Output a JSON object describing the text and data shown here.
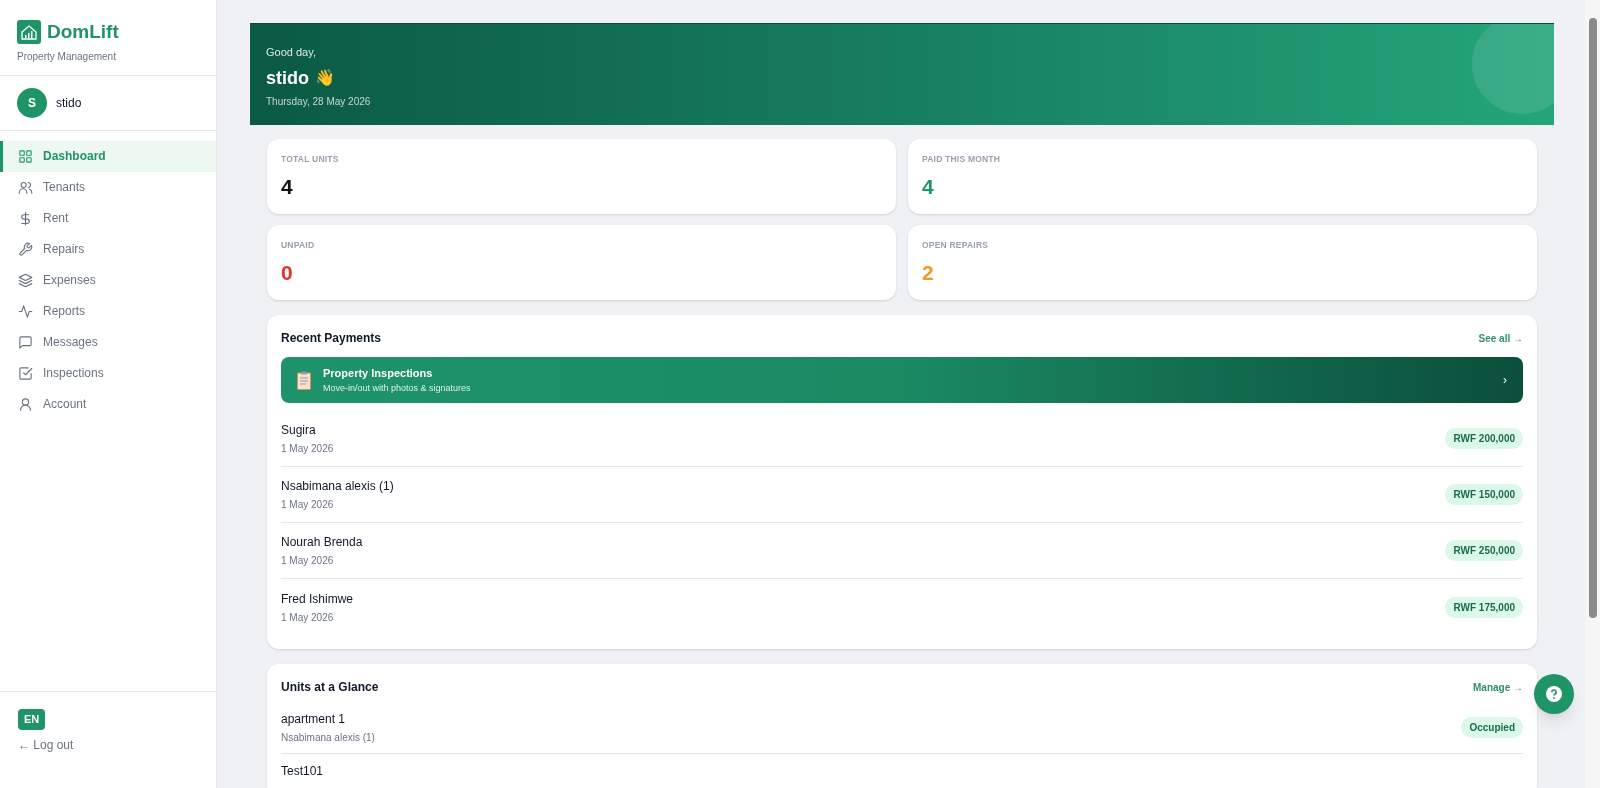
{
  "brand": {
    "name": "DomLift",
    "tagline": "Property Management"
  },
  "user": {
    "initial": "S",
    "name": "stido"
  },
  "nav": [
    {
      "label": "Dashboard",
      "selected": true
    },
    {
      "label": "Tenants",
      "selected": false
    },
    {
      "label": "Rent",
      "selected": false
    },
    {
      "label": "Repairs",
      "selected": false
    },
    {
      "label": "Expenses",
      "selected": false
    },
    {
      "label": "Reports",
      "selected": false
    },
    {
      "label": "Messages",
      "selected": false
    },
    {
      "label": "Inspections",
      "selected": false
    },
    {
      "label": "Account",
      "selected": false
    }
  ],
  "language": "EN",
  "logout": "← Log out",
  "greeting": {
    "salutation": "Good day,",
    "name": "stido",
    "emoji": "👋",
    "date": "Thursday, 28 May 2026"
  },
  "stats": [
    {
      "label": "TOTAL UNITS",
      "value": "4",
      "color": "#111111"
    },
    {
      "label": "PAID THIS MONTH",
      "value": "4",
      "color": "#1f9467"
    },
    {
      "label": "UNPAID",
      "value": "0",
      "color": "#e5322d"
    },
    {
      "label": "OPEN REPAIRS",
      "value": "2",
      "color": "#f29a1f"
    }
  ],
  "recent_payments": {
    "title": "Recent Payments",
    "link": "See all →",
    "promo": {
      "title": "Property Inspections",
      "subtitle": "Move-in/out with photos & signatures",
      "chevron": "›"
    },
    "rows": [
      {
        "name": "Sugira",
        "date": "1 May 2026",
        "amount": "RWF 200,000"
      },
      {
        "name": "Nsabimana alexis (1)",
        "date": "1 May 2026",
        "amount": "RWF 150,000"
      },
      {
        "name": "Nourah Brenda",
        "date": "1 May 2026",
        "amount": "RWF 250,000"
      },
      {
        "name": "Fred Ishimwe",
        "date": "1 May 2026",
        "amount": "RWF 175,000"
      }
    ]
  },
  "units": {
    "title": "Units at a Glance",
    "link": "Manage →",
    "rows": [
      {
        "name": "apartment 1",
        "tenant": "Nsabimana alexis (1)",
        "status": "Occupied"
      },
      {
        "name": "Test101"
      }
    ]
  }
}
